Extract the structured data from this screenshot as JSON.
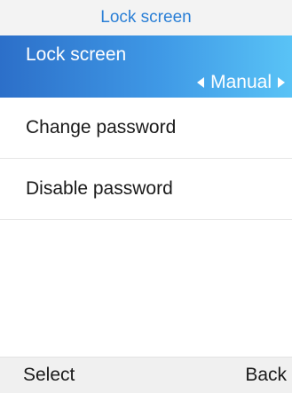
{
  "header": {
    "title": "Lock screen"
  },
  "menu": {
    "items": [
      {
        "label": "Lock screen",
        "value": "Manual",
        "selected": true
      },
      {
        "label": "Change password"
      },
      {
        "label": "Disable password"
      }
    ]
  },
  "softkeys": {
    "left": "Select",
    "right": "Back"
  },
  "colors": {
    "accent": "#2a7fd6",
    "selected_start": "#2c6fc9",
    "selected_end": "#59c3f6"
  },
  "icons": {
    "prev": "triangle-left-icon",
    "next": "triangle-right-icon"
  }
}
